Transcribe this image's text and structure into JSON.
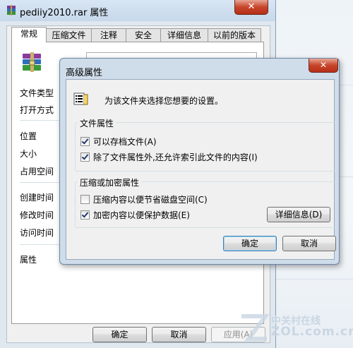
{
  "back_window": {
    "title": "pediiy2010.rar 属性",
    "tabs": [
      "常规",
      "压缩文件",
      "注释",
      "安全",
      "详细信息",
      "以前的版本"
    ],
    "labels": [
      "文件类型",
      "打开方式",
      "位置",
      "大小",
      "占用空间",
      "创建时间",
      "修改时间",
      "访问时间",
      "属性"
    ],
    "buttons": {
      "ok": "确定",
      "cancel": "取消",
      "apply": "应用(A)"
    }
  },
  "dialog": {
    "title": "高级属性",
    "description": "为该文件夹选择您想要的设置。",
    "file_attributes": {
      "title": "文件属性",
      "items": [
        {
          "label": "可以存档文件(A)",
          "checked": true
        },
        {
          "label": "除了文件属性外,还允许索引此文件的内容(I)",
          "checked": true
        }
      ]
    },
    "compress_encrypt": {
      "title": "压缩或加密属性",
      "items": [
        {
          "label": "压缩内容以便节省磁盘空间(C)",
          "checked": false
        },
        {
          "label": "加密内容以便保护数据(E)",
          "checked": true
        }
      ],
      "details_button": "详细信息(D)"
    },
    "buttons": {
      "ok": "确定",
      "cancel": "取消"
    }
  },
  "watermark": {
    "line1": "中关村在线",
    "line2": "ZOL.com.cn"
  },
  "colors": {
    "close_red": "#c7452b",
    "title_blue": "#cfdcea",
    "default_button_border": "#3c7fb1"
  }
}
